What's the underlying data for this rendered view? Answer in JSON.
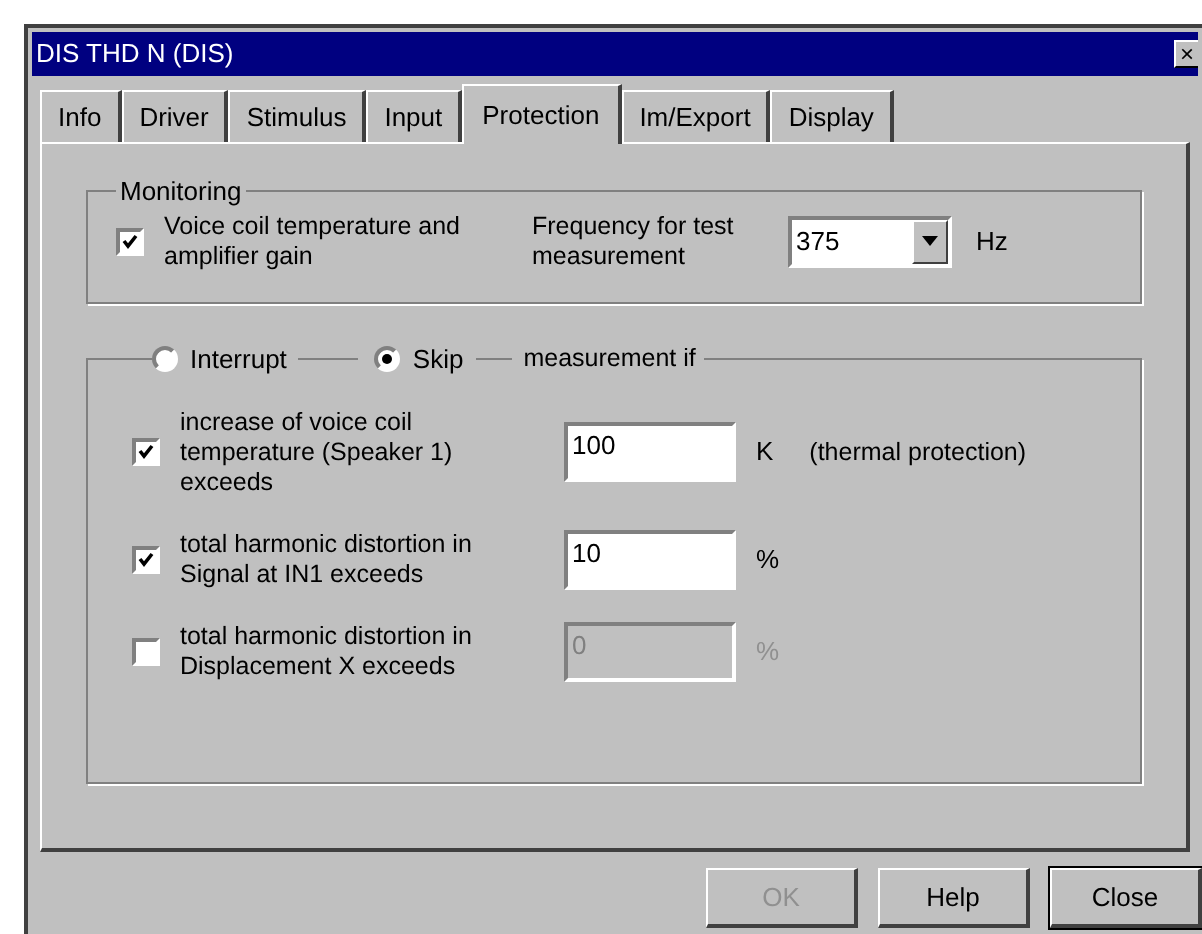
{
  "window": {
    "title": "DIS THD N (DIS)",
    "close": "×"
  },
  "tabs": [
    {
      "label": "Info",
      "selected": false
    },
    {
      "label": "Driver",
      "selected": false
    },
    {
      "label": "Stimulus",
      "selected": false
    },
    {
      "label": "Input",
      "selected": false
    },
    {
      "label": "Protection",
      "selected": true
    },
    {
      "label": "Im/Export",
      "selected": false
    },
    {
      "label": "Display",
      "selected": false
    }
  ],
  "monitoring": {
    "legend": "Monitoring",
    "checkbox": {
      "label": "Voice coil temperature and amplifier gain",
      "checked": true
    },
    "frequency_label": "Frequency for test measurement",
    "frequency": {
      "value": "375"
    },
    "unit": "Hz"
  },
  "measurement": {
    "options": [
      {
        "label": "Interrupt",
        "selected": false
      },
      {
        "label": "Skip",
        "selected": true
      }
    ],
    "legend_suffix": "measurement if",
    "conditions": [
      {
        "label": "increase of voice coil temperature (Speaker 1) exceeds",
        "checked": true,
        "value": "100",
        "unit": "K",
        "note": "(thermal protection)",
        "disabled": false
      },
      {
        "label": "total harmonic distortion in Signal at IN1 exceeds",
        "checked": true,
        "value": "10",
        "unit": "%",
        "disabled": false
      },
      {
        "label": "total harmonic distortion in Displacement X exceeds",
        "checked": false,
        "value": "0",
        "unit": "%",
        "disabled": true
      }
    ]
  },
  "buttons": [
    {
      "label": "OK",
      "disabled": true,
      "default": false
    },
    {
      "label": "Help",
      "disabled": false,
      "default": false
    },
    {
      "label": "Close",
      "disabled": false,
      "default": true
    }
  ]
}
